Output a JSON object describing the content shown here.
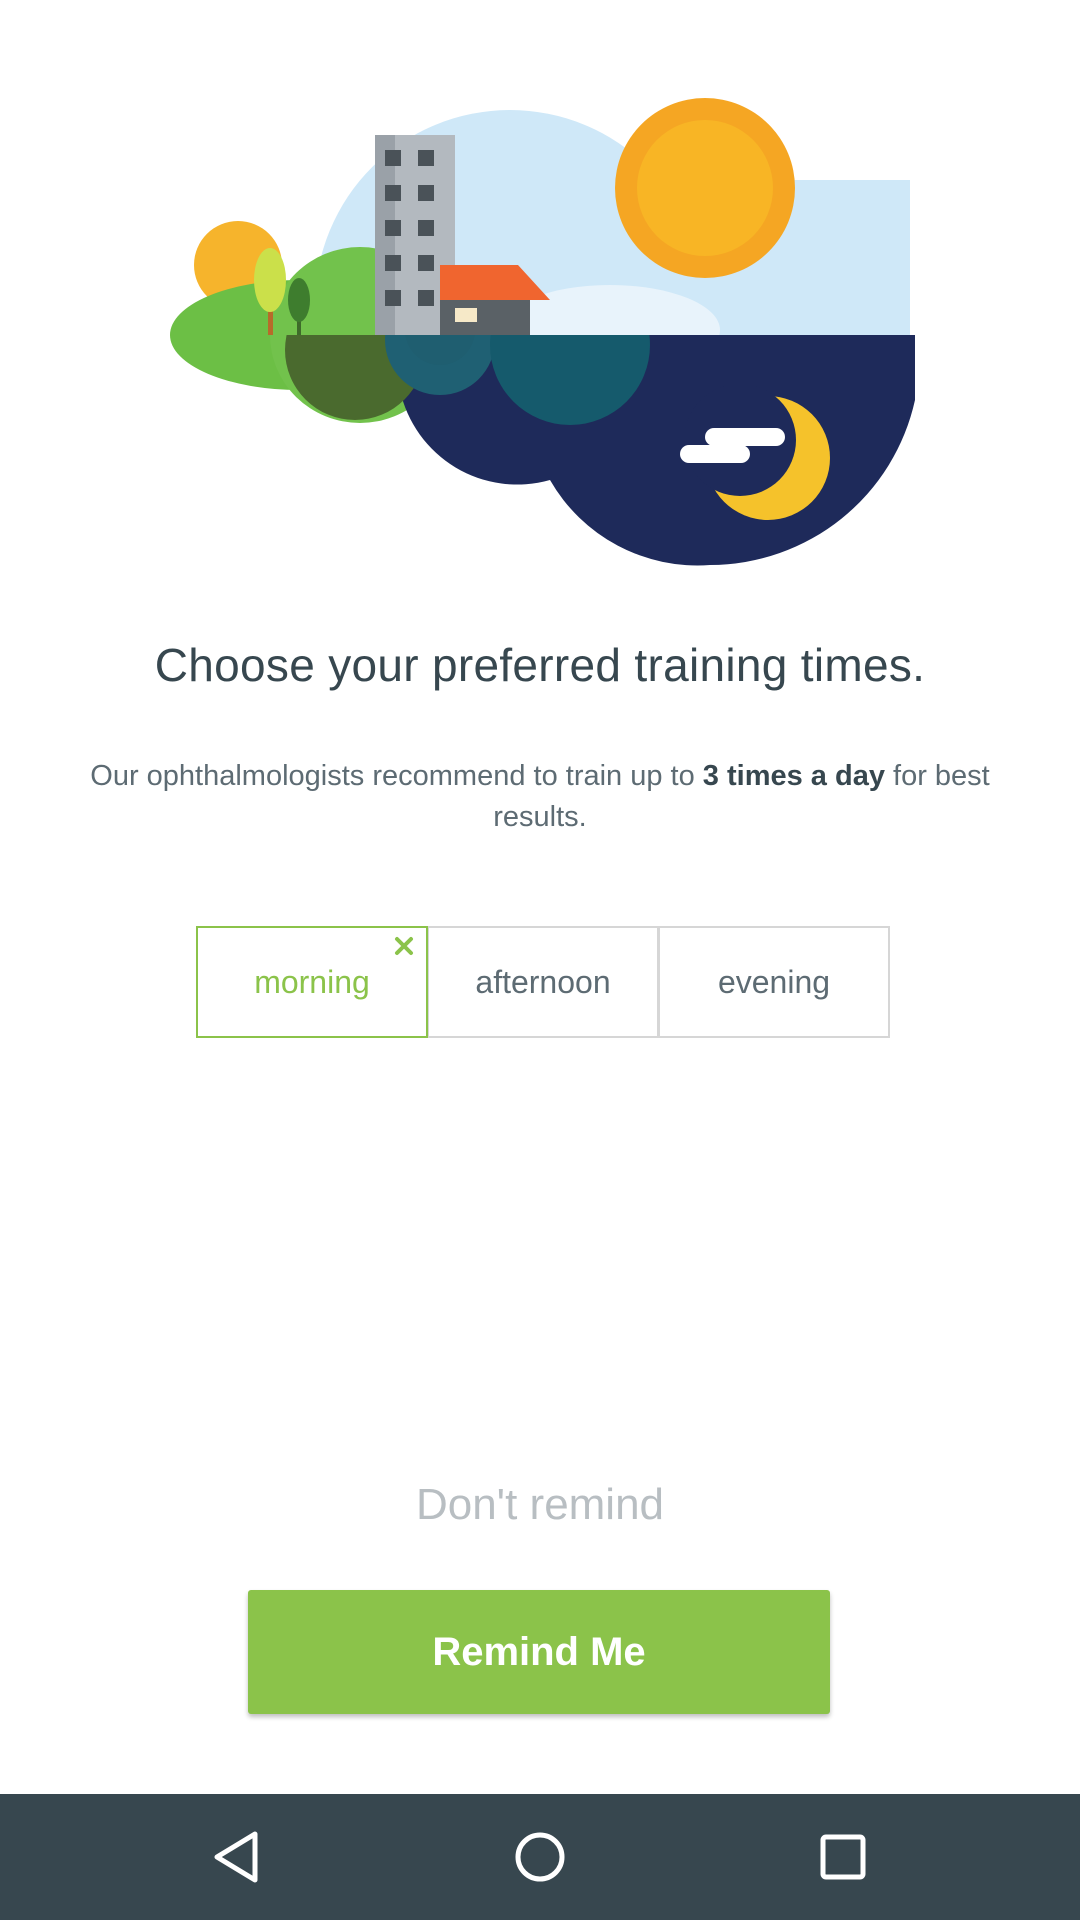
{
  "illustration": {
    "name": "day-night-scene",
    "colors": {
      "sky": "#cfe8f8",
      "sun": "#f5a623",
      "grass": "#6cbf45",
      "night": "#1e2a5a",
      "moon": "#f5c22b",
      "roof": "#f0652f"
    }
  },
  "heading": {
    "title": "Choose your preferred training times.",
    "subtitle_part1": "Our ophthalmologists recommend to train up to ",
    "subtitle_bold": "3 times a day",
    "subtitle_part2": " for best results."
  },
  "time_options": [
    {
      "label": "morning",
      "selected": true
    },
    {
      "label": "afternoon",
      "selected": false
    },
    {
      "label": "evening",
      "selected": false
    }
  ],
  "actions": {
    "dont_remind": "Don't remind",
    "remind_me": "Remind Me"
  },
  "colors": {
    "accent": "#8bc34a",
    "text_dark": "#37474f",
    "nav_bar": "#37474f"
  },
  "nav_bar": {
    "buttons": [
      {
        "icon": "back-triangle-icon"
      },
      {
        "icon": "home-circle-icon"
      },
      {
        "icon": "recents-square-icon"
      }
    ]
  }
}
